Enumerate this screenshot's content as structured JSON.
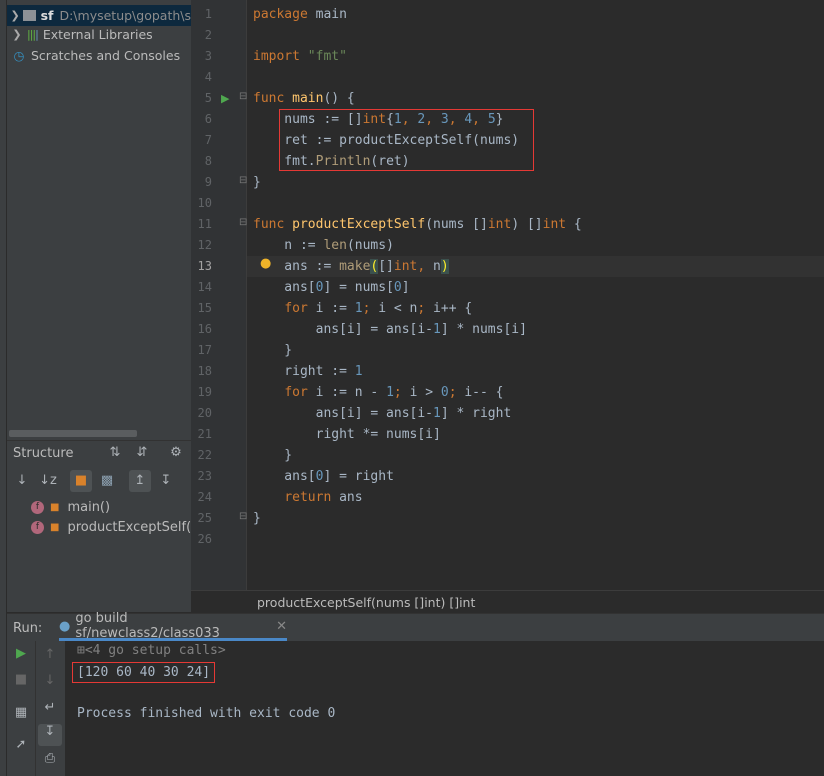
{
  "project_tree": {
    "items": [
      {
        "name": "sf",
        "path": "D:\\mysetup\\gopath\\s",
        "selected": true,
        "icon": "folder-icon"
      },
      {
        "name": "External Libraries",
        "icon": "library-icon"
      },
      {
        "name": "Scratches and Consoles",
        "icon": "scratches-icon"
      }
    ]
  },
  "structure": {
    "title": "Structure",
    "members": [
      {
        "badge": "f",
        "label": "main()"
      },
      {
        "badge": "f",
        "label": "productExceptSelf(nu"
      }
    ]
  },
  "editor": {
    "current_line": 13,
    "lines": [
      [
        [
          "k",
          "package "
        ],
        [
          "p",
          "main"
        ]
      ],
      [],
      [
        [
          "k",
          "import "
        ],
        [
          "s",
          "\"fmt\""
        ]
      ],
      [],
      [
        [
          "k",
          "func "
        ],
        [
          "f",
          "main"
        ],
        [
          "p",
          "() {"
        ]
      ],
      [
        [
          "p",
          "    nums := []"
        ],
        [
          "k",
          "int"
        ],
        [
          "p",
          "{"
        ],
        [
          "n",
          "1"
        ],
        [
          "k",
          ", "
        ],
        [
          "n",
          "2"
        ],
        [
          "k",
          ", "
        ],
        [
          "n",
          "3"
        ],
        [
          "k",
          ", "
        ],
        [
          "n",
          "4"
        ],
        [
          "k",
          ", "
        ],
        [
          "n",
          "5"
        ],
        [
          "p",
          "}"
        ]
      ],
      [
        [
          "p",
          "    ret := "
        ],
        [
          "c",
          "productExceptSelf"
        ],
        [
          "p",
          "(nums)"
        ]
      ],
      [
        [
          "p",
          "    fmt."
        ],
        [
          "m",
          "Println"
        ],
        [
          "p",
          "(ret)"
        ]
      ],
      [
        [
          "p",
          "}"
        ]
      ],
      [],
      [
        [
          "k",
          "func "
        ],
        [
          "f",
          "productExceptSelf"
        ],
        [
          "p",
          "(nums []"
        ],
        [
          "k",
          "int"
        ],
        [
          "p",
          ") []"
        ],
        [
          "k",
          "int"
        ],
        [
          "p",
          " {"
        ]
      ],
      [
        [
          "p",
          "    n := "
        ],
        [
          "m",
          "len"
        ],
        [
          "p",
          "(nums)"
        ]
      ],
      [
        [
          "p",
          "    ans := "
        ],
        [
          "m",
          "make"
        ],
        [
          "b",
          "("
        ],
        [
          "p",
          "[]"
        ],
        [
          "k",
          "int"
        ],
        [
          "k",
          ", "
        ],
        [
          "p",
          "n"
        ],
        [
          "b",
          ")"
        ]
      ],
      [
        [
          "p",
          "    ans["
        ],
        [
          "n",
          "0"
        ],
        [
          "p",
          "] = nums["
        ],
        [
          "n",
          "0"
        ],
        [
          "p",
          "]"
        ]
      ],
      [
        [
          "p",
          "    "
        ],
        [
          "k",
          "for "
        ],
        [
          "p",
          "i := "
        ],
        [
          "n",
          "1"
        ],
        [
          "k",
          "; "
        ],
        [
          "p",
          "i < n"
        ],
        [
          "k",
          "; "
        ],
        [
          "p",
          "i++ {"
        ]
      ],
      [
        [
          "p",
          "        ans[i] = ans[i-"
        ],
        [
          "n",
          "1"
        ],
        [
          "p",
          "] * nums[i]"
        ]
      ],
      [
        [
          "p",
          "    }"
        ]
      ],
      [
        [
          "p",
          "    right := "
        ],
        [
          "n",
          "1"
        ]
      ],
      [
        [
          "p",
          "    "
        ],
        [
          "k",
          "for "
        ],
        [
          "p",
          "i := n - "
        ],
        [
          "n",
          "1"
        ],
        [
          "k",
          "; "
        ],
        [
          "p",
          "i > "
        ],
        [
          "n",
          "0"
        ],
        [
          "k",
          "; "
        ],
        [
          "p",
          "i-- {"
        ]
      ],
      [
        [
          "p",
          "        ans[i] = ans[i-"
        ],
        [
          "n",
          "1"
        ],
        [
          "p",
          "] * right"
        ]
      ],
      [
        [
          "p",
          "        right *= nums[i]"
        ]
      ],
      [
        [
          "p",
          "    }"
        ]
      ],
      [
        [
          "p",
          "    ans["
        ],
        [
          "n",
          "0"
        ],
        [
          "p",
          "] = right"
        ]
      ],
      [
        [
          "p",
          "    "
        ],
        [
          "k",
          "return "
        ],
        [
          "p",
          "ans"
        ]
      ],
      [
        [
          "p",
          "}"
        ]
      ],
      []
    ],
    "breadcrumb": "productExceptSelf(nums []int) []int"
  },
  "run": {
    "label": "Run:",
    "tab": "go build sf/newclass2/class033",
    "console": [
      "<4 go setup calls>",
      "[120 60 40 30 24]",
      "",
      "Process finished with exit code 0"
    ]
  },
  "colors": {
    "keyword": "#cc7832",
    "number": "#6897bb",
    "string": "#6a8759",
    "function": "#ffc66d",
    "highlight_box": "#e53935"
  }
}
